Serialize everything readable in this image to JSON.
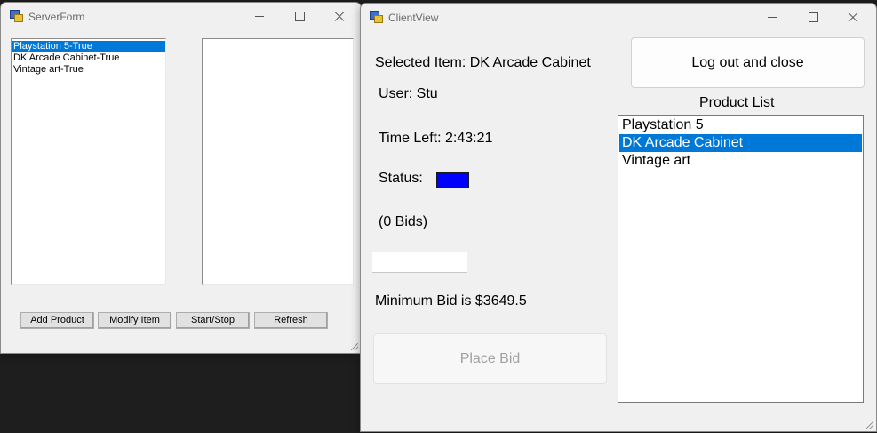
{
  "server_form": {
    "title": "ServerForm",
    "items": [
      "Playstation 5-True",
      "DK Arcade Cabinet-True",
      "Vintage art-True"
    ],
    "selected_index": 0,
    "buttons": {
      "add_product": "Add Product",
      "modify_item": "Modify Item",
      "start_stop": "Start/Stop",
      "refresh": "Refresh"
    }
  },
  "client_view": {
    "title": "ClientView",
    "selected_item": "Selected Item: DK Arcade Cabinet",
    "user": "User: Stu",
    "time_left": "Time Left: 2:43:21",
    "status_label": "Status:",
    "status_color": "#0000ff",
    "bids": "(0 Bids)",
    "bid_input_value": "",
    "minimum_bid": "Minimum Bid is $3649.5",
    "place_bid": "Place Bid",
    "logout": "Log out and close",
    "product_list_label": "Product List",
    "products": [
      "Playstation 5",
      "DK Arcade Cabinet",
      "Vintage art"
    ],
    "selected_product_index": 1
  },
  "colors": {
    "selection": "#0078d7",
    "window_bg": "#f0f0f0",
    "desktop_bg": "#1e1e1e"
  }
}
